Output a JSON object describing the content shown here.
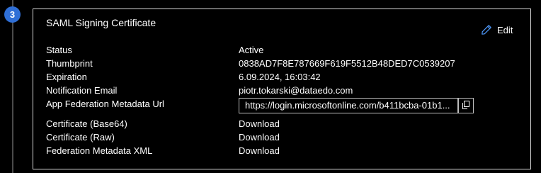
{
  "step": {
    "number": "3",
    "color": "#2f6fd6"
  },
  "card": {
    "title": "SAML Signing Certificate",
    "edit_label": "Edit",
    "edit_icon": "pencil-icon"
  },
  "fields": {
    "status": {
      "label": "Status",
      "value": "Active"
    },
    "thumbprint": {
      "label": "Thumbprint",
      "value": "0838AD7F8E787669F619F5512B48DED7C0539207"
    },
    "expiration": {
      "label": "Expiration",
      "value": "6.09.2024, 16:03:42"
    },
    "notification_email": {
      "label": "Notification Email",
      "value": "piotr.tokarski@dataedo.com"
    },
    "metadata_url": {
      "label": "App Federation Metadata Url",
      "value": "https://login.microsoftonline.com/b411bcba-01b1...",
      "copy_icon": "copy-icon"
    },
    "cert_base64": {
      "label": "Certificate (Base64)",
      "link": "Download"
    },
    "cert_raw": {
      "label": "Certificate (Raw)",
      "link": "Download"
    },
    "federation_xml": {
      "label": "Federation Metadata XML",
      "link": "Download"
    }
  },
  "colors": {
    "link": "#4f9bff",
    "background": "#000000",
    "border": "#d8d8d8"
  }
}
